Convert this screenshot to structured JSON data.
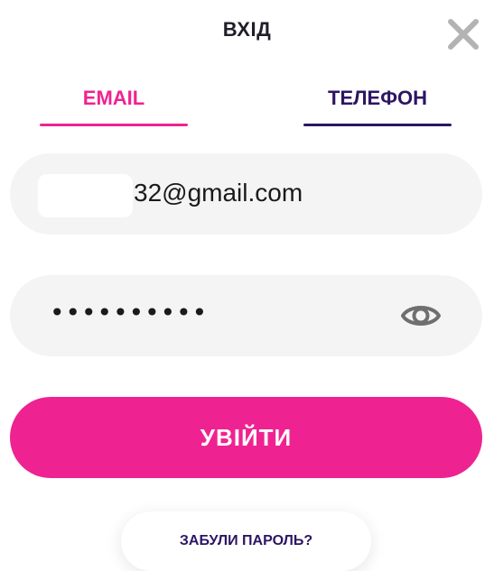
{
  "header": {
    "title": "ВХІД",
    "close_icon": "close-icon"
  },
  "tabs": [
    {
      "label": "EMAIL",
      "active": true,
      "color": "#ef2391"
    },
    {
      "label": "ТЕЛЕФОН",
      "active": false,
      "color": "#2d1563"
    }
  ],
  "form": {
    "email_value": "32@gmail.com",
    "password_value": "••••••••••",
    "show_password_icon": "eye-icon"
  },
  "actions": {
    "login_label": "УВІЙТИ",
    "forgot_password_label": "ЗАБУЛИ ПАРОЛЬ?"
  },
  "colors": {
    "accent": "#ee2391",
    "brand_dark": "#2d1563",
    "field_background": "#f4f4f4"
  }
}
